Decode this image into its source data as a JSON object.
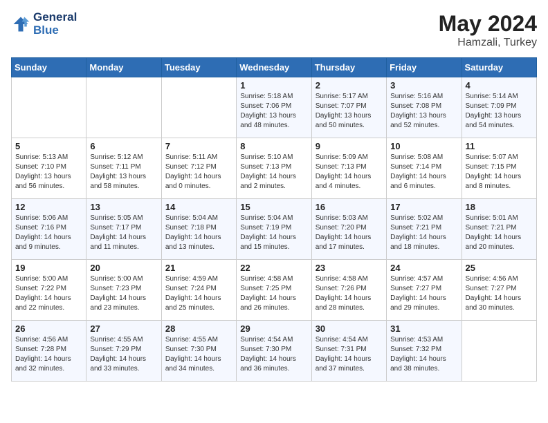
{
  "header": {
    "logo_line1": "General",
    "logo_line2": "Blue",
    "month": "May 2024",
    "location": "Hamzali, Turkey"
  },
  "days_of_week": [
    "Sunday",
    "Monday",
    "Tuesday",
    "Wednesday",
    "Thursday",
    "Friday",
    "Saturday"
  ],
  "weeks": [
    [
      {
        "day": "",
        "sunrise": "",
        "sunset": "",
        "daylight": ""
      },
      {
        "day": "",
        "sunrise": "",
        "sunset": "",
        "daylight": ""
      },
      {
        "day": "",
        "sunrise": "",
        "sunset": "",
        "daylight": ""
      },
      {
        "day": "1",
        "sunrise": "Sunrise: 5:18 AM",
        "sunset": "Sunset: 7:06 PM",
        "daylight": "Daylight: 13 hours and 48 minutes."
      },
      {
        "day": "2",
        "sunrise": "Sunrise: 5:17 AM",
        "sunset": "Sunset: 7:07 PM",
        "daylight": "Daylight: 13 hours and 50 minutes."
      },
      {
        "day": "3",
        "sunrise": "Sunrise: 5:16 AM",
        "sunset": "Sunset: 7:08 PM",
        "daylight": "Daylight: 13 hours and 52 minutes."
      },
      {
        "day": "4",
        "sunrise": "Sunrise: 5:14 AM",
        "sunset": "Sunset: 7:09 PM",
        "daylight": "Daylight: 13 hours and 54 minutes."
      }
    ],
    [
      {
        "day": "5",
        "sunrise": "Sunrise: 5:13 AM",
        "sunset": "Sunset: 7:10 PM",
        "daylight": "Daylight: 13 hours and 56 minutes."
      },
      {
        "day": "6",
        "sunrise": "Sunrise: 5:12 AM",
        "sunset": "Sunset: 7:11 PM",
        "daylight": "Daylight: 13 hours and 58 minutes."
      },
      {
        "day": "7",
        "sunrise": "Sunrise: 5:11 AM",
        "sunset": "Sunset: 7:12 PM",
        "daylight": "Daylight: 14 hours and 0 minutes."
      },
      {
        "day": "8",
        "sunrise": "Sunrise: 5:10 AM",
        "sunset": "Sunset: 7:13 PM",
        "daylight": "Daylight: 14 hours and 2 minutes."
      },
      {
        "day": "9",
        "sunrise": "Sunrise: 5:09 AM",
        "sunset": "Sunset: 7:13 PM",
        "daylight": "Daylight: 14 hours and 4 minutes."
      },
      {
        "day": "10",
        "sunrise": "Sunrise: 5:08 AM",
        "sunset": "Sunset: 7:14 PM",
        "daylight": "Daylight: 14 hours and 6 minutes."
      },
      {
        "day": "11",
        "sunrise": "Sunrise: 5:07 AM",
        "sunset": "Sunset: 7:15 PM",
        "daylight": "Daylight: 14 hours and 8 minutes."
      }
    ],
    [
      {
        "day": "12",
        "sunrise": "Sunrise: 5:06 AM",
        "sunset": "Sunset: 7:16 PM",
        "daylight": "Daylight: 14 hours and 9 minutes."
      },
      {
        "day": "13",
        "sunrise": "Sunrise: 5:05 AM",
        "sunset": "Sunset: 7:17 PM",
        "daylight": "Daylight: 14 hours and 11 minutes."
      },
      {
        "day": "14",
        "sunrise": "Sunrise: 5:04 AM",
        "sunset": "Sunset: 7:18 PM",
        "daylight": "Daylight: 14 hours and 13 minutes."
      },
      {
        "day": "15",
        "sunrise": "Sunrise: 5:04 AM",
        "sunset": "Sunset: 7:19 PM",
        "daylight": "Daylight: 14 hours and 15 minutes."
      },
      {
        "day": "16",
        "sunrise": "Sunrise: 5:03 AM",
        "sunset": "Sunset: 7:20 PM",
        "daylight": "Daylight: 14 hours and 17 minutes."
      },
      {
        "day": "17",
        "sunrise": "Sunrise: 5:02 AM",
        "sunset": "Sunset: 7:21 PM",
        "daylight": "Daylight: 14 hours and 18 minutes."
      },
      {
        "day": "18",
        "sunrise": "Sunrise: 5:01 AM",
        "sunset": "Sunset: 7:21 PM",
        "daylight": "Daylight: 14 hours and 20 minutes."
      }
    ],
    [
      {
        "day": "19",
        "sunrise": "Sunrise: 5:00 AM",
        "sunset": "Sunset: 7:22 PM",
        "daylight": "Daylight: 14 hours and 22 minutes."
      },
      {
        "day": "20",
        "sunrise": "Sunrise: 5:00 AM",
        "sunset": "Sunset: 7:23 PM",
        "daylight": "Daylight: 14 hours and 23 minutes."
      },
      {
        "day": "21",
        "sunrise": "Sunrise: 4:59 AM",
        "sunset": "Sunset: 7:24 PM",
        "daylight": "Daylight: 14 hours and 25 minutes."
      },
      {
        "day": "22",
        "sunrise": "Sunrise: 4:58 AM",
        "sunset": "Sunset: 7:25 PM",
        "daylight": "Daylight: 14 hours and 26 minutes."
      },
      {
        "day": "23",
        "sunrise": "Sunrise: 4:58 AM",
        "sunset": "Sunset: 7:26 PM",
        "daylight": "Daylight: 14 hours and 28 minutes."
      },
      {
        "day": "24",
        "sunrise": "Sunrise: 4:57 AM",
        "sunset": "Sunset: 7:27 PM",
        "daylight": "Daylight: 14 hours and 29 minutes."
      },
      {
        "day": "25",
        "sunrise": "Sunrise: 4:56 AM",
        "sunset": "Sunset: 7:27 PM",
        "daylight": "Daylight: 14 hours and 30 minutes."
      }
    ],
    [
      {
        "day": "26",
        "sunrise": "Sunrise: 4:56 AM",
        "sunset": "Sunset: 7:28 PM",
        "daylight": "Daylight: 14 hours and 32 minutes."
      },
      {
        "day": "27",
        "sunrise": "Sunrise: 4:55 AM",
        "sunset": "Sunset: 7:29 PM",
        "daylight": "Daylight: 14 hours and 33 minutes."
      },
      {
        "day": "28",
        "sunrise": "Sunrise: 4:55 AM",
        "sunset": "Sunset: 7:30 PM",
        "daylight": "Daylight: 14 hours and 34 minutes."
      },
      {
        "day": "29",
        "sunrise": "Sunrise: 4:54 AM",
        "sunset": "Sunset: 7:30 PM",
        "daylight": "Daylight: 14 hours and 36 minutes."
      },
      {
        "day": "30",
        "sunrise": "Sunrise: 4:54 AM",
        "sunset": "Sunset: 7:31 PM",
        "daylight": "Daylight: 14 hours and 37 minutes."
      },
      {
        "day": "31",
        "sunrise": "Sunrise: 4:53 AM",
        "sunset": "Sunset: 7:32 PM",
        "daylight": "Daylight: 14 hours and 38 minutes."
      },
      {
        "day": "",
        "sunrise": "",
        "sunset": "",
        "daylight": ""
      }
    ]
  ]
}
